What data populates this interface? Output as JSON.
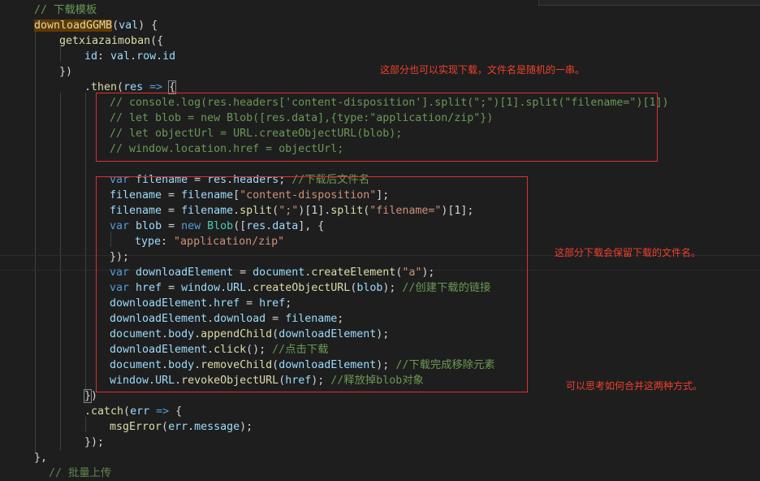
{
  "code_lines": [
    "// 下载模板",
    "downloadGGMB(val) {",
    "getxiazaimoban({",
    "id: val.row.id",
    "})",
    ".then(res => {",
    "// console.log(res.headers['content-disposition'].split(\";\")[1].split(\"filename=\")[1])",
    "// let blob = new Blob([res.data],{type:\"application/zip\"})",
    "// let objectUrl = URL.createObjectURL(blob);",
    "// window.location.href = objectUrl;",
    "",
    "var filename = res.headers; //下载后文件名",
    "filename = filename[\"content-disposition\"];",
    "filename = filename.split(\";\")[1].split(\"filename=\")[1];",
    "var blob = new Blob([res.data], {",
    "type: \"application/zip\"",
    "});",
    "var downloadElement = document.createElement(\"a\");",
    "var href = window.URL.createObjectURL(blob); //创建下载的链接",
    "downloadElement.href = href;",
    "downloadElement.download = filename;",
    "document.body.appendChild(downloadElement);",
    "downloadElement.click(); //点击下载",
    "document.body.removeChild(downloadElement); //下载完成移除元素",
    "window.URL.revokeObjectURL(href); //释放掉blob对象",
    "})",
    ".catch(err => {",
    "msgError(err.message);",
    "});",
    "},",
    "// 批量上传"
  ],
  "annotations": {
    "note_top": "这部分也可以实现下载，文件名是随机的一串。",
    "note_middle": "这部分下载会保留下载的文件名。",
    "note_bottom": "可以思考如何合并这两种方式。"
  },
  "colors": {
    "background": "#1e1e1e",
    "comment": "#6a9955",
    "keyword": "#569cd6",
    "function": "#dcdcaa",
    "variable": "#9cdcfe",
    "string": "#ce9178",
    "annotation_red": "#e0302e"
  }
}
